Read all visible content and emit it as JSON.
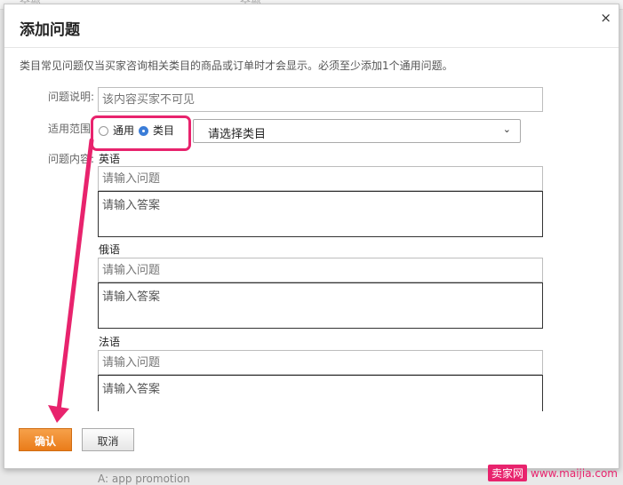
{
  "background": {
    "top_a": "全部",
    "top_b": "全部",
    "bottom_text": "A: app promotion"
  },
  "dialog": {
    "title": "添加问题",
    "notice": "类目常见问题仅当买家咨询相关类目的商品或订单时才会显示。必须至少添加1个通用问题。",
    "desc_label": "问题说明:",
    "desc_placeholder": "该内容买家不可见",
    "scope_label": "适用范围:",
    "scope_options": [
      "通用",
      "类目"
    ],
    "scope_selected": "类目",
    "category_select": "请选择类目",
    "content_label": "问题内容:",
    "languages": [
      {
        "name": "英语",
        "question_placeholder": "请输入问题",
        "answer_placeholder": "请输入答案"
      },
      {
        "name": "俄语",
        "question_placeholder": "请输入问题",
        "answer_placeholder": "请输入答案"
      },
      {
        "name": "法语",
        "question_placeholder": "请输入问题",
        "answer_placeholder": "请输入答案"
      }
    ],
    "confirm_label": "确认",
    "cancel_label": "取消",
    "close_symbol": "×"
  },
  "watermark": {
    "brand": "卖家网",
    "url": "www.maijia.com"
  },
  "colors": {
    "highlight": "#e8236d",
    "confirm": "#ea7c1a",
    "radio_on": "#3b7dd8"
  }
}
